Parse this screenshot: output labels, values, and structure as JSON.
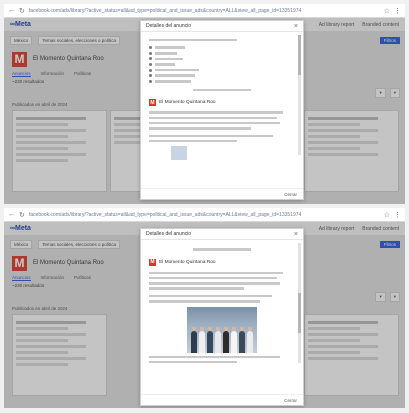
{
  "browser": {
    "url_top": "facebook.com/ads/library/?active_status=all&ad_type=political_and_issue_ads&country=ALL&view_all_page_id=13351974",
    "url_bottom": "facebook.com/ads/library/?active_status=all&ad_type=political_and_issue_ads&country=ALL&view_all_page_id=13351974"
  },
  "app": {
    "brand": "∞Meta",
    "nav_links": [
      "Ad library report",
      "Branded content"
    ],
    "filter_chips": [
      "México",
      "Temas sociales, elecciones o política"
    ],
    "filter_button": "Filtros",
    "page_name": "El Momento Quintana Roo",
    "tabs": [
      "Anuncios",
      "Información",
      "Políticas"
    ],
    "results": "~230 resultados",
    "published_since": "Publicados en abril de 2024"
  },
  "modal_top": {
    "title": "Detalles del anuncio",
    "close_label": "Cerrar",
    "page_title": "El Momento Quintana Roo"
  },
  "modal_bottom": {
    "title": "Detalles del anuncio",
    "close_label": "Cerrar",
    "page_title": "El Momento Quintana Roo"
  },
  "colors": {
    "accent": "#2b57d6",
    "logo_red": "#d9372b"
  }
}
